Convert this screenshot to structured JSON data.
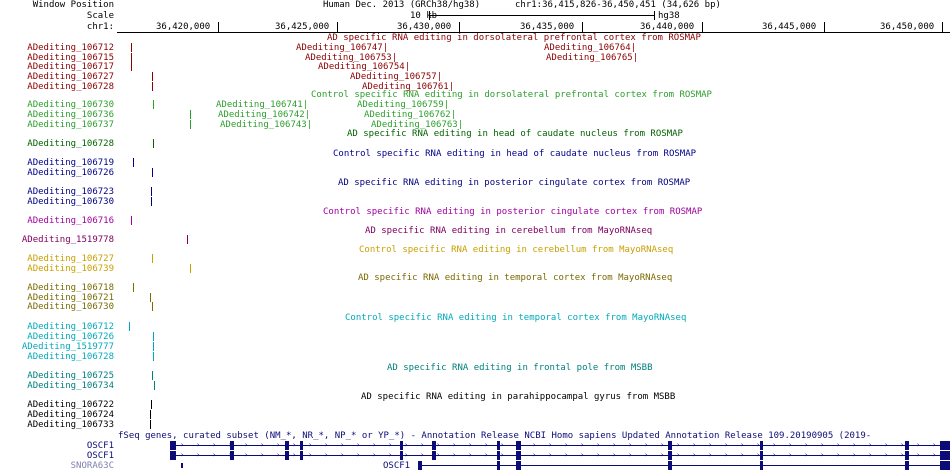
{
  "header": {
    "window_position_label": "Window Position",
    "scale_label": "Scale",
    "chrom_label": "chr1:",
    "assembly": "Human Dec. 2013 (GRCh38/hg38)",
    "position": "chr1:36,415,826-36,450,451 (34,626 bp)",
    "scale_value": "10 kb",
    "scale_assembly": "hg38",
    "ruler_ticks": [
      "36,420,000",
      "36,425,000",
      "36,430,000",
      "36,435,000",
      "36,440,000",
      "36,445,000",
      "36,450,000"
    ]
  },
  "colors": {
    "darkred": "#8b0000",
    "green": "#2ca02c",
    "darkgreen": "#006400",
    "navy": "#00008b",
    "darkblue": "#000080",
    "magenta": "#a000a0",
    "purple": "#800060",
    "gold": "#c8a000",
    "olive": "#7a6a00",
    "cyan": "#00aabb",
    "teal": "#008080",
    "black": "#000000",
    "gene": "#0c0c78"
  },
  "tracks": [
    {
      "title": "AD specific RNA editing in dorsolateral prefrontal cortex from ROSMAP",
      "color": "#8b0000",
      "rows": [
        "ADediting_106712",
        "ADediting_106715",
        "ADediting_106717",
        "ADediting_106727",
        "ADediting_106728"
      ],
      "items": [
        "ADediting_106747",
        "ADediting_106753",
        "ADediting_106754",
        "ADediting_106757",
        "ADediting_106761",
        "ADediting_106764",
        "ADediting_106765"
      ]
    },
    {
      "title": "Control specific RNA editing in dorsolateral prefrontal cortex from ROSMAP",
      "color": "#2ca02c",
      "rows": [
        "ADediting_106730",
        "ADediting_106736",
        "ADediting_106737"
      ],
      "items": [
        "ADediting_106741",
        "ADediting_106742",
        "ADediting_106743",
        "ADediting_106759",
        "ADediting_106762",
        "ADediting_106763"
      ]
    },
    {
      "title": "AD specific RNA editing in head of caudate nucleus from ROSMAP",
      "color": "#006400",
      "rows": [
        "ADediting_106728"
      ]
    },
    {
      "title": "Control specific RNA editing in head of caudate nucleus from ROSMAP",
      "color": "#00008b",
      "rows": [
        "ADediting_106719",
        "ADediting_106726"
      ]
    },
    {
      "title": "AD specific RNA editing in posterior cingulate cortex from ROSMAP",
      "color": "#000080",
      "rows": [
        "ADediting_106723",
        "ADediting_106730"
      ]
    },
    {
      "title": "Control specific RNA editing in posterior cingulate cortex from ROSMAP",
      "color": "#a000a0",
      "rows": [
        "ADediting_106716"
      ]
    },
    {
      "title": "AD specific RNA editing in cerebellum from MayoRNAseq",
      "color": "#800060",
      "rows": [
        "ADediting_1519778"
      ]
    },
    {
      "title": "Control specific RNA editing in cerebellum from MayoRNAseq",
      "color": "#c8a000",
      "rows": [
        "ADediting_106727",
        "ADediting_106739"
      ]
    },
    {
      "title": "AD specific RNA editing in temporal cortex from MayoRNAseq",
      "color": "#7a6a00",
      "rows": [
        "ADediting_106718",
        "ADediting_106721",
        "ADediting_106730"
      ]
    },
    {
      "title": "Control specific RNA editing in temporal cortex from MayoRNAseq",
      "color": "#00aabb",
      "rows": [
        "ADediting_106712",
        "ADediting_106726",
        "ADediting_1519777",
        "ADediting_106728"
      ]
    },
    {
      "title": "AD specific RNA editing in frontal pole from MSBB",
      "color": "#008080",
      "rows": [
        "ADediting_106725",
        "ADediting_106734"
      ]
    },
    {
      "title": "AD specific RNA editing in parahippocampal gyrus from MSBB",
      "color": "#000000",
      "rows": [
        "ADediting_106722",
        "ADediting_106724",
        "ADediting_106733"
      ]
    }
  ],
  "genes": {
    "title": "fSeq genes, curated subset (NM_*, NR_*, NP_* or YP_*) - Annotation Release NCBI Homo sapiens Updated Annotation Release 109.20190905 (2019-",
    "rows": [
      "OSCF1",
      "OSCF1",
      "SNORA63C"
    ],
    "inline_label": "OSCF1"
  }
}
